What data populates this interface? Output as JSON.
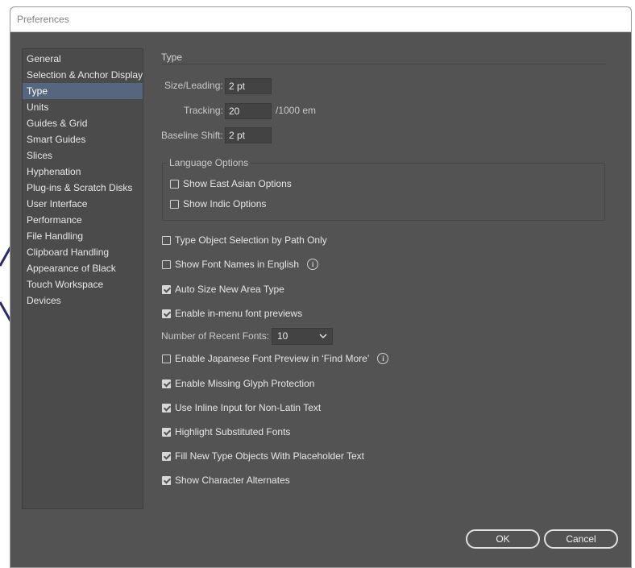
{
  "window": {
    "title": "Preferences"
  },
  "sidebar": {
    "items": [
      {
        "label": "General"
      },
      {
        "label": "Selection & Anchor Display"
      },
      {
        "label": "Type"
      },
      {
        "label": "Units"
      },
      {
        "label": "Guides & Grid"
      },
      {
        "label": "Smart Guides"
      },
      {
        "label": "Slices"
      },
      {
        "label": "Hyphenation"
      },
      {
        "label": "Plug-ins & Scratch Disks"
      },
      {
        "label": "User Interface"
      },
      {
        "label": "Performance"
      },
      {
        "label": "File Handling"
      },
      {
        "label": "Clipboard Handling"
      },
      {
        "label": "Appearance of Black"
      },
      {
        "label": "Touch Workspace"
      },
      {
        "label": "Devices"
      }
    ],
    "selected": "Type"
  },
  "panel": {
    "title": "Type",
    "size_leading": {
      "label": "Size/Leading:",
      "value": "2 pt"
    },
    "tracking": {
      "label": "Tracking:",
      "value": "20",
      "unit": "/1000 em"
    },
    "baseline_shift": {
      "label": "Baseline Shift:",
      "value": "2 pt"
    },
    "language_options": {
      "title": "Language Options",
      "show_east_asian": {
        "label": "Show East Asian Options",
        "checked": false
      },
      "show_indic": {
        "label": "Show Indic Options",
        "checked": false
      }
    },
    "options": {
      "type_object_selection": {
        "label": "Type Object Selection by Path Only",
        "checked": false
      },
      "font_names_english": {
        "label": "Show Font Names in English",
        "checked": false
      },
      "auto_size": {
        "label": "Auto Size New Area Type",
        "checked": true
      },
      "in_menu_previews": {
        "label": "Enable in-menu font previews",
        "checked": true
      },
      "japanese_preview": {
        "label": "Enable Japanese Font Preview in ‘Find More’",
        "checked": false
      },
      "missing_glyph": {
        "label": "Enable Missing Glyph Protection",
        "checked": true
      },
      "inline_input": {
        "label": "Use Inline Input for Non-Latin Text",
        "checked": true
      },
      "highlight_substituted": {
        "label": "Highlight Substituted Fonts",
        "checked": true
      },
      "placeholder_text": {
        "label": "Fill New Type Objects With Placeholder Text",
        "checked": true
      },
      "character_alternates": {
        "label": "Show Character Alternates",
        "checked": true
      }
    },
    "recent_fonts": {
      "label": "Number of Recent Fonts:",
      "value": "10"
    }
  },
  "buttons": {
    "ok": "OK",
    "cancel": "Cancel"
  },
  "colors": {
    "background": "#535353",
    "selected": "#56667e",
    "text": "#e6e6e6"
  }
}
